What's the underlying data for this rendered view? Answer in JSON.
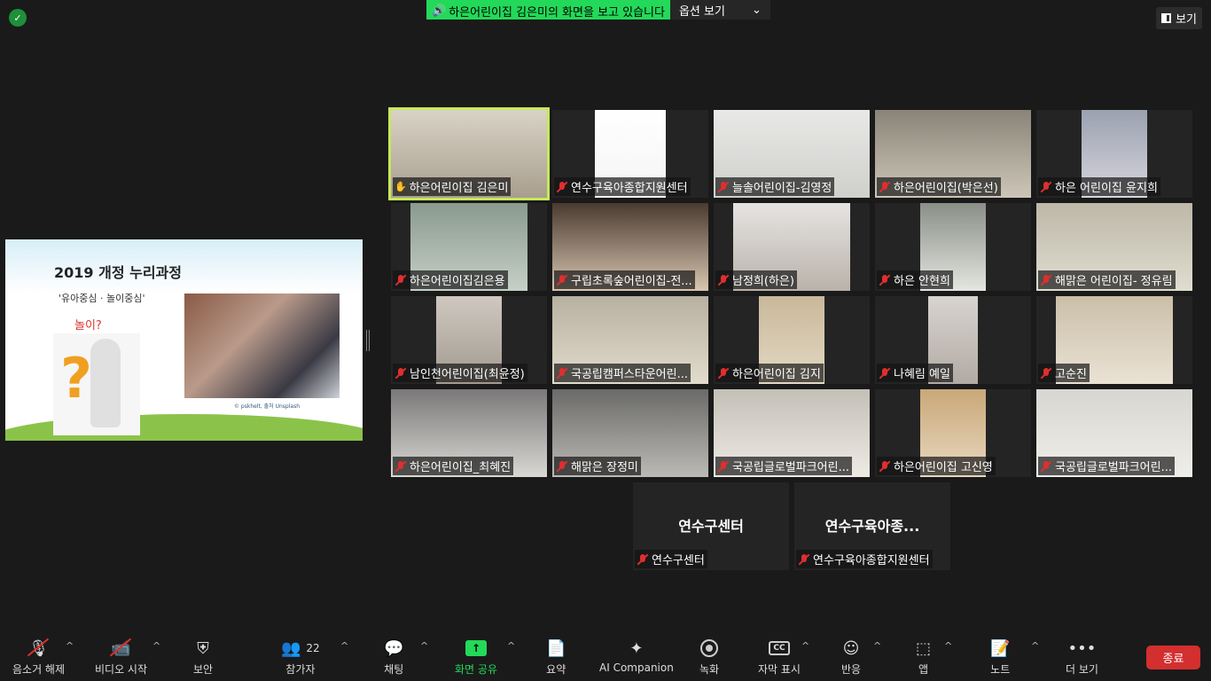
{
  "top": {
    "banner_text": "하은어린이집 김은미의 화면을 보고 있습니다",
    "options_label": "옵션 보기",
    "view_label": "보기"
  },
  "slide": {
    "title": "2019 개정 누리과정",
    "subtitle": "'유아중심 · 놀이중심'",
    "question": "놀이?",
    "credit": "© pskhelt, 출처 Unsplash"
  },
  "participants": [
    {
      "name": "하은어린이집 김은미",
      "icon": "raised-hand"
    },
    {
      "name": "연수구육아종합지원센터",
      "icon": "mic-muted"
    },
    {
      "name": "늘솔어린이집-김영정",
      "icon": "mic-muted"
    },
    {
      "name": "하은어린이집(박은선)",
      "icon": "mic-muted"
    },
    {
      "name": "하은 어린이집 윤지희",
      "icon": "mic-muted"
    },
    {
      "name": "하은어린이집김은용",
      "icon": "mic-muted"
    },
    {
      "name": "구립초록숲어린이집-전...",
      "icon": "mic-muted"
    },
    {
      "name": "남정희(하은)",
      "icon": "mic-muted"
    },
    {
      "name": "하은 안현희",
      "icon": "mic-muted"
    },
    {
      "name": "해맑은 어린이집- 정유림",
      "icon": "mic-muted"
    },
    {
      "name": "남인천어린이집(최윤정)",
      "icon": "mic-muted"
    },
    {
      "name": "국공립캠퍼스타운어린...",
      "icon": "mic-muted"
    },
    {
      "name": "하은어린이집 김지",
      "icon": "mic-muted"
    },
    {
      "name": "나혜림 예일",
      "icon": "mic-muted"
    },
    {
      "name": "고순진",
      "icon": "mic-muted"
    },
    {
      "name": "하은어린이집_최혜진",
      "icon": "mic-muted"
    },
    {
      "name": "해맑은 장정미",
      "icon": "mic-muted"
    },
    {
      "name": "국공립글로벌파크어린...",
      "icon": "mic-muted"
    },
    {
      "name": "하은어린이집 고신영",
      "icon": "mic-muted"
    },
    {
      "name": "국공립글로벌파크어린...",
      "icon": "mic-muted"
    },
    {
      "name": "연수구센터",
      "big": "연수구센터",
      "icon": "mic-muted"
    },
    {
      "name": "연수구육아종합지원센터",
      "big": "연수구육아종...",
      "icon": "mic-muted"
    }
  ],
  "toolbar": {
    "unmute": "음소거 해제",
    "video": "비디오 시작",
    "security": "보안",
    "participants": "참가자",
    "participants_count": "22",
    "chat": "채팅",
    "share": "화면 공유",
    "summary": "요약",
    "ai": "AI Companion",
    "record": "녹화",
    "captions": "자막 표시",
    "captions_icon": "CC",
    "reactions": "반응",
    "apps": "앱",
    "notes": "노트",
    "more": "더 보기",
    "end": "종료"
  }
}
